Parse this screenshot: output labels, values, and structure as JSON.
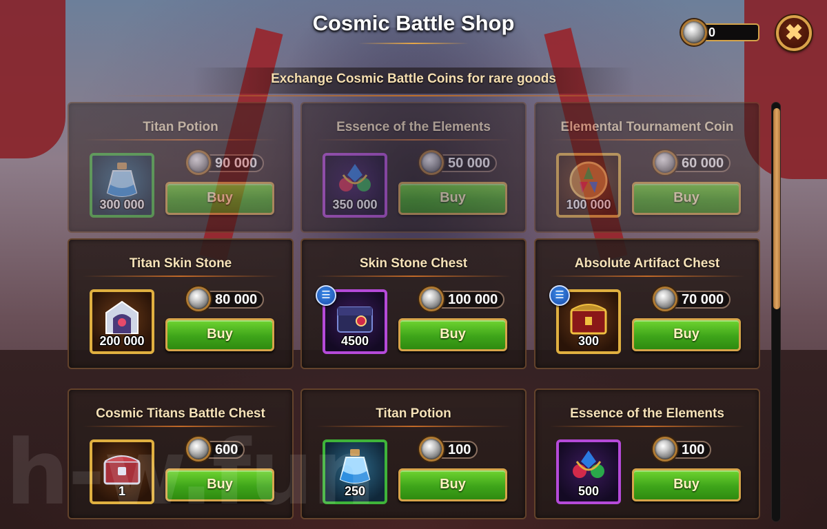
{
  "header": {
    "title": "Cosmic Battle Shop",
    "subtitle": "Exchange Cosmic Battle Coins for rare goods"
  },
  "currency": {
    "icon": "cosmic-coin-icon",
    "amount": "0"
  },
  "close": {
    "icon": "close-icon",
    "glyph": "✖"
  },
  "buy_label": "Buy",
  "items": [
    {
      "name": "Titan Potion",
      "price": "90 000",
      "qty": "300 000",
      "frame": "green",
      "icon": "potion-icon",
      "info": false,
      "dim": true
    },
    {
      "name": "Essence of the Elements",
      "price": "50 000",
      "qty": "350 000",
      "frame": "purple",
      "icon": "essence-icon",
      "info": false,
      "dim": true
    },
    {
      "name": "Elemental Tournament Coin",
      "price": "60 000",
      "qty": "100 000",
      "frame": "gold",
      "icon": "tournament-coin-icon",
      "info": false,
      "dim": true
    },
    {
      "name": "Titan Skin Stone",
      "price": "80 000",
      "qty": "200 000",
      "frame": "gold",
      "icon": "skin-stone-icon",
      "info": false,
      "dim": false
    },
    {
      "name": "Skin Stone Chest",
      "price": "100 000",
      "qty": "4500",
      "frame": "purple",
      "icon": "chest-icon",
      "info": true,
      "dim": false
    },
    {
      "name": "Absolute Artifact Chest",
      "price": "70 000",
      "qty": "300",
      "frame": "gold",
      "icon": "artifact-chest-icon",
      "info": true,
      "dim": false
    },
    {
      "name": "Cosmic Titans Battle Chest",
      "price": "600",
      "qty": "1",
      "frame": "gold",
      "icon": "battle-chest-icon",
      "info": false,
      "dim": false
    },
    {
      "name": "Titan Potion",
      "price": "100",
      "qty": "250",
      "frame": "green",
      "icon": "potion-icon",
      "info": false,
      "dim": false
    },
    {
      "name": "Essence of the Elements",
      "price": "100",
      "qty": "500",
      "frame": "purple",
      "icon": "essence-icon",
      "info": false,
      "dim": false
    }
  ],
  "info_glyph": "☰",
  "watermark": "h-w.fun"
}
